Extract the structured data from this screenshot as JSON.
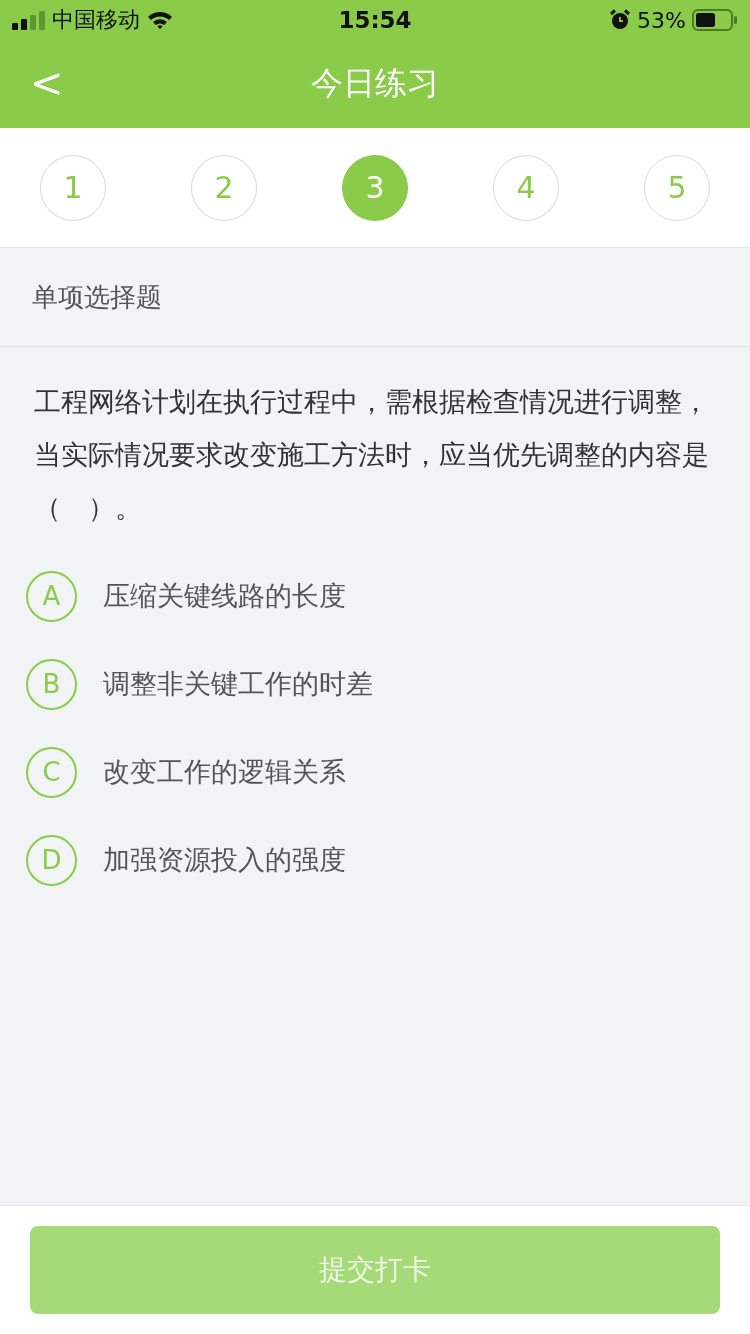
{
  "status_bar": {
    "carrier": "中国移动",
    "time": "15:54",
    "battery": "53%"
  },
  "nav": {
    "back": "<",
    "title": "今日练习"
  },
  "steps": [
    {
      "label": "1",
      "selected": false
    },
    {
      "label": "2",
      "selected": false
    },
    {
      "label": "3",
      "selected": true
    },
    {
      "label": "4",
      "selected": false
    },
    {
      "label": "5",
      "selected": false
    }
  ],
  "question_type": "单项选择题",
  "question": "工程网络计划在执行过程中，需根据检查情况进行调整，当实际情况要求改变施工方法时，应当优先调整的内容是（　）。",
  "options": [
    {
      "letter": "A",
      "text": "压缩关键线路的长度",
      "selected": false
    },
    {
      "letter": "B",
      "text": "调整非关键工作的时差",
      "selected": false
    },
    {
      "letter": "C",
      "text": "改变工作的逻辑关系",
      "selected": false
    },
    {
      "letter": "D",
      "text": "加强资源投入的强度",
      "selected": false
    }
  ],
  "submit": {
    "label": "提交打卡",
    "disabled": true
  }
}
